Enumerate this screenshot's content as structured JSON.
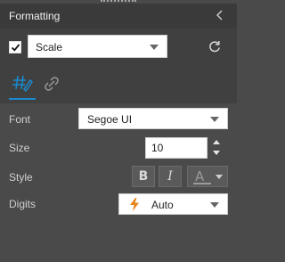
{
  "header": {
    "title": "Formatting",
    "collapse_icon": "chevron-left-icon"
  },
  "scale": {
    "enabled": true,
    "selected": "Scale",
    "reset_icon": "reset-icon"
  },
  "tabs": [
    {
      "name": "format-tab",
      "icon": "format-number-icon",
      "active": true
    },
    {
      "name": "link-tab",
      "icon": "link-icon",
      "active": false
    }
  ],
  "fields": {
    "font_label": "Font",
    "font_value": "Segoe UI",
    "size_label": "Size",
    "size_value": "10",
    "style_label": "Style",
    "bold_label": "B",
    "italic_label": "I",
    "color_letter": "A",
    "digits_label": "Digits",
    "digits_value": "Auto"
  },
  "colors": {
    "accent": "#1a8ad0",
    "bolt": "#e8841a",
    "panel": "#4a4a4a",
    "header": "#3a3a3a"
  }
}
